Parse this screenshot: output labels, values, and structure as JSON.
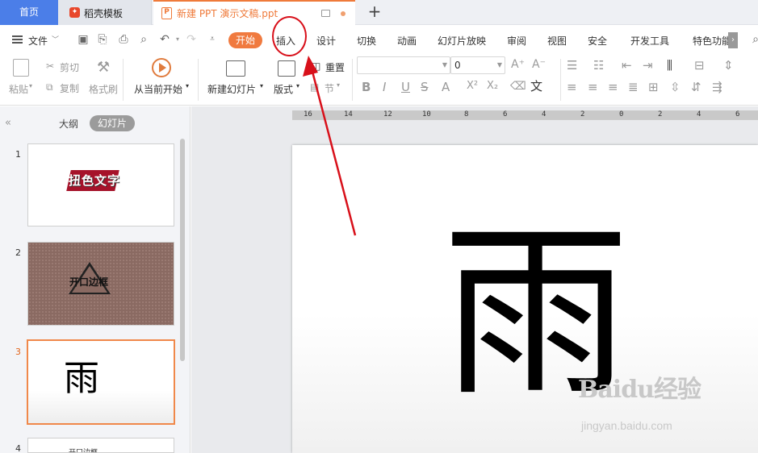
{
  "tabs": {
    "home": "首页",
    "template": "稻壳模板",
    "document": "新建 PPT 演示文稿.ppt",
    "add": "+"
  },
  "menu": {
    "file": "文件",
    "start": "开始",
    "items": [
      "插入",
      "设计",
      "切换",
      "动画",
      "幻灯片放映",
      "审阅",
      "视图",
      "安全",
      "开发工具",
      "特色功能"
    ]
  },
  "ribbon": {
    "paste": "粘贴",
    "cut": "剪切",
    "copy": "复制",
    "format_painter": "格式刷",
    "from_current": "从当前开始",
    "new_slide": "新建幻灯片",
    "layout": "版式",
    "reset": "重置",
    "section": "节",
    "font_size": "0",
    "font_name": ""
  },
  "left_panel": {
    "outline_tab": "大纲",
    "slides_tab": "幻灯片",
    "slides": [
      {
        "number": "1",
        "text": "扭色文字"
      },
      {
        "number": "2",
        "text": "开口边框"
      },
      {
        "number": "3",
        "text": "雨"
      },
      {
        "number": "4",
        "text": "开口边框"
      }
    ]
  },
  "ruler": [
    "16",
    "14",
    "12",
    "10",
    "8",
    "6",
    "4",
    "2",
    "0",
    "2",
    "4",
    "6"
  ],
  "slide": {
    "main_char": "雨"
  },
  "watermark": {
    "brand": "Baidu经验",
    "url": "jingyan.baidu.com"
  },
  "colors": {
    "accent_orange": "#f07a3f",
    "home_blue": "#4b7ee8",
    "annotation_red": "#d8101a"
  }
}
